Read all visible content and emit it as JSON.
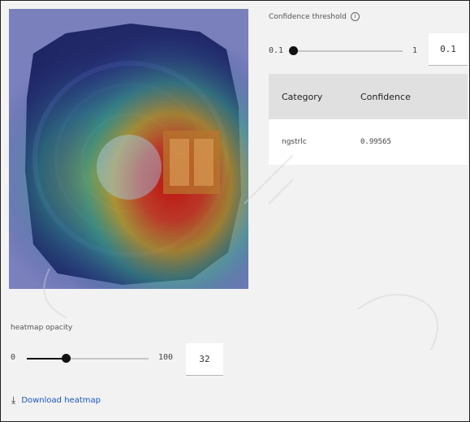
{
  "image_panel": {},
  "heatmap_opacity": {
    "label": "heatmap opacity",
    "min": "0",
    "max": "100",
    "value": "32",
    "fraction": 0.32
  },
  "download": {
    "icon": "download-icon",
    "label": "Download heatmap"
  },
  "confidence_threshold": {
    "label": "Confidence threshold",
    "info_icon": "info-icon",
    "min": "0.1",
    "max": "1",
    "value": "0.1",
    "fraction": 0.0
  },
  "results_table": {
    "headers": [
      "Category",
      "Confidence"
    ],
    "rows": [
      [
        "ngstrlc",
        "0.99565"
      ]
    ]
  },
  "colors": {
    "accent": "#1a56c8",
    "slider_active": "#111111",
    "table_header_bg": "#e0e0e0"
  }
}
